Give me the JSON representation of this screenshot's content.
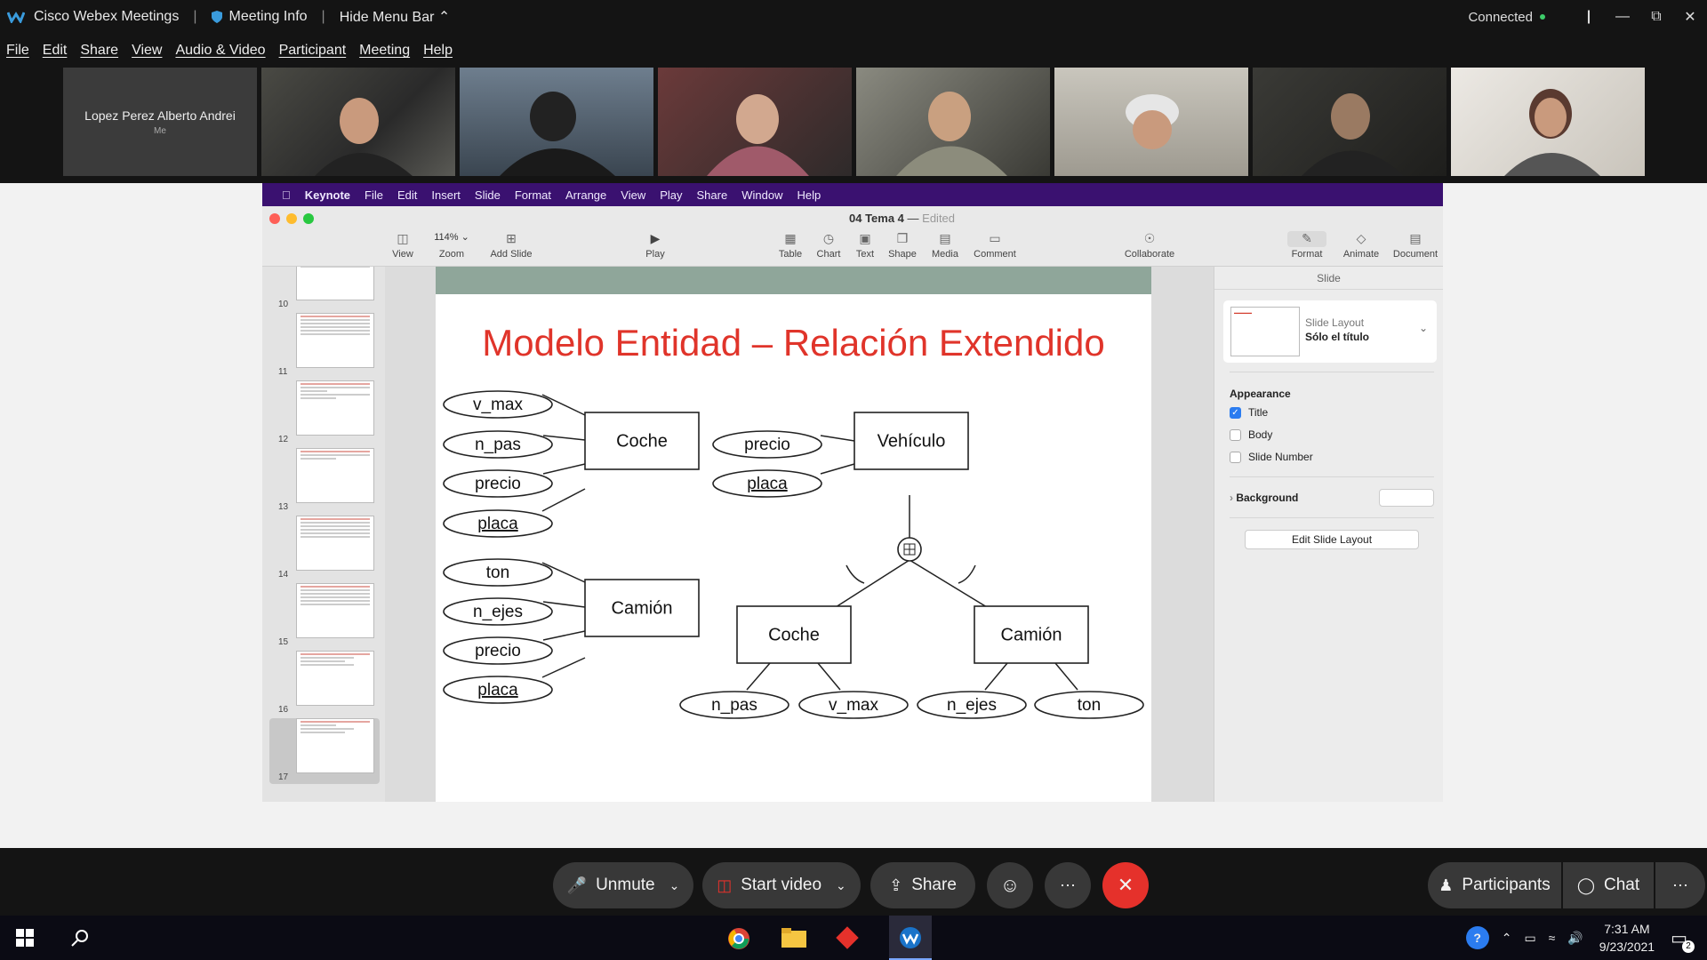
{
  "window": {
    "app_title": "Cisco Webex Meetings",
    "meeting_info": "Meeting Info",
    "hide_menu": "Hide Menu Bar",
    "status": "Connected"
  },
  "menu": [
    "File",
    "Edit",
    "Share",
    "View",
    "Audio & Video",
    "Participant",
    "Meeting",
    "Help"
  ],
  "participants": {
    "me_name": "Lopez Perez Alberto Andrei",
    "me_label": "Me"
  },
  "keynote": {
    "menu": [
      "Keynote",
      "File",
      "Edit",
      "Insert",
      "Slide",
      "Format",
      "Arrange",
      "View",
      "Play",
      "Share",
      "Window",
      "Help"
    ],
    "doc_title": "04 Tema 4",
    "doc_status": "Edited",
    "toolbar": {
      "view": "View",
      "zoom_value": "114%",
      "zoom": "Zoom",
      "add_slide": "Add Slide",
      "play": "Play",
      "table": "Table",
      "chart": "Chart",
      "text": "Text",
      "shape": "Shape",
      "media": "Media",
      "comment": "Comment",
      "collaborate": "Collaborate",
      "format": "Format",
      "animate": "Animate",
      "document": "Document"
    },
    "slide_numbers": [
      "10",
      "11",
      "12",
      "13",
      "14",
      "15",
      "16",
      "17"
    ],
    "slide": {
      "title": "Modelo Entidad – Relación Extendido",
      "entities": {
        "coche1": "Coche",
        "vehiculo": "Vehículo",
        "camion1": "Camión",
        "coche2": "Coche",
        "camion2": "Camión"
      },
      "attrs": {
        "v_max": "v_max",
        "n_pas": "n_pas",
        "precio": "precio",
        "placa": "placa",
        "ton": "ton",
        "n_ejes": "n_ejes"
      }
    },
    "inspector": {
      "tab": "Slide",
      "layout_label": "Slide Layout",
      "layout_value": "Sólo el título",
      "appearance": "Appearance",
      "title": "Title",
      "body": "Body",
      "slide_number": "Slide Number",
      "background": "Background",
      "edit_layout": "Edit Slide Layout",
      "title_checked": true
    }
  },
  "controls": {
    "unmute": "Unmute",
    "start_video": "Start video",
    "share": "Share",
    "participants": "Participants",
    "chat": "Chat"
  },
  "taskbar": {
    "time": "7:31 AM",
    "date": "9/23/2021",
    "notif_count": "2"
  },
  "colors": {
    "webex_bg": "#141414",
    "keynote_menu": "#3a1170",
    "slide_title_red": "#e0342a",
    "end_red": "#e5312b"
  }
}
